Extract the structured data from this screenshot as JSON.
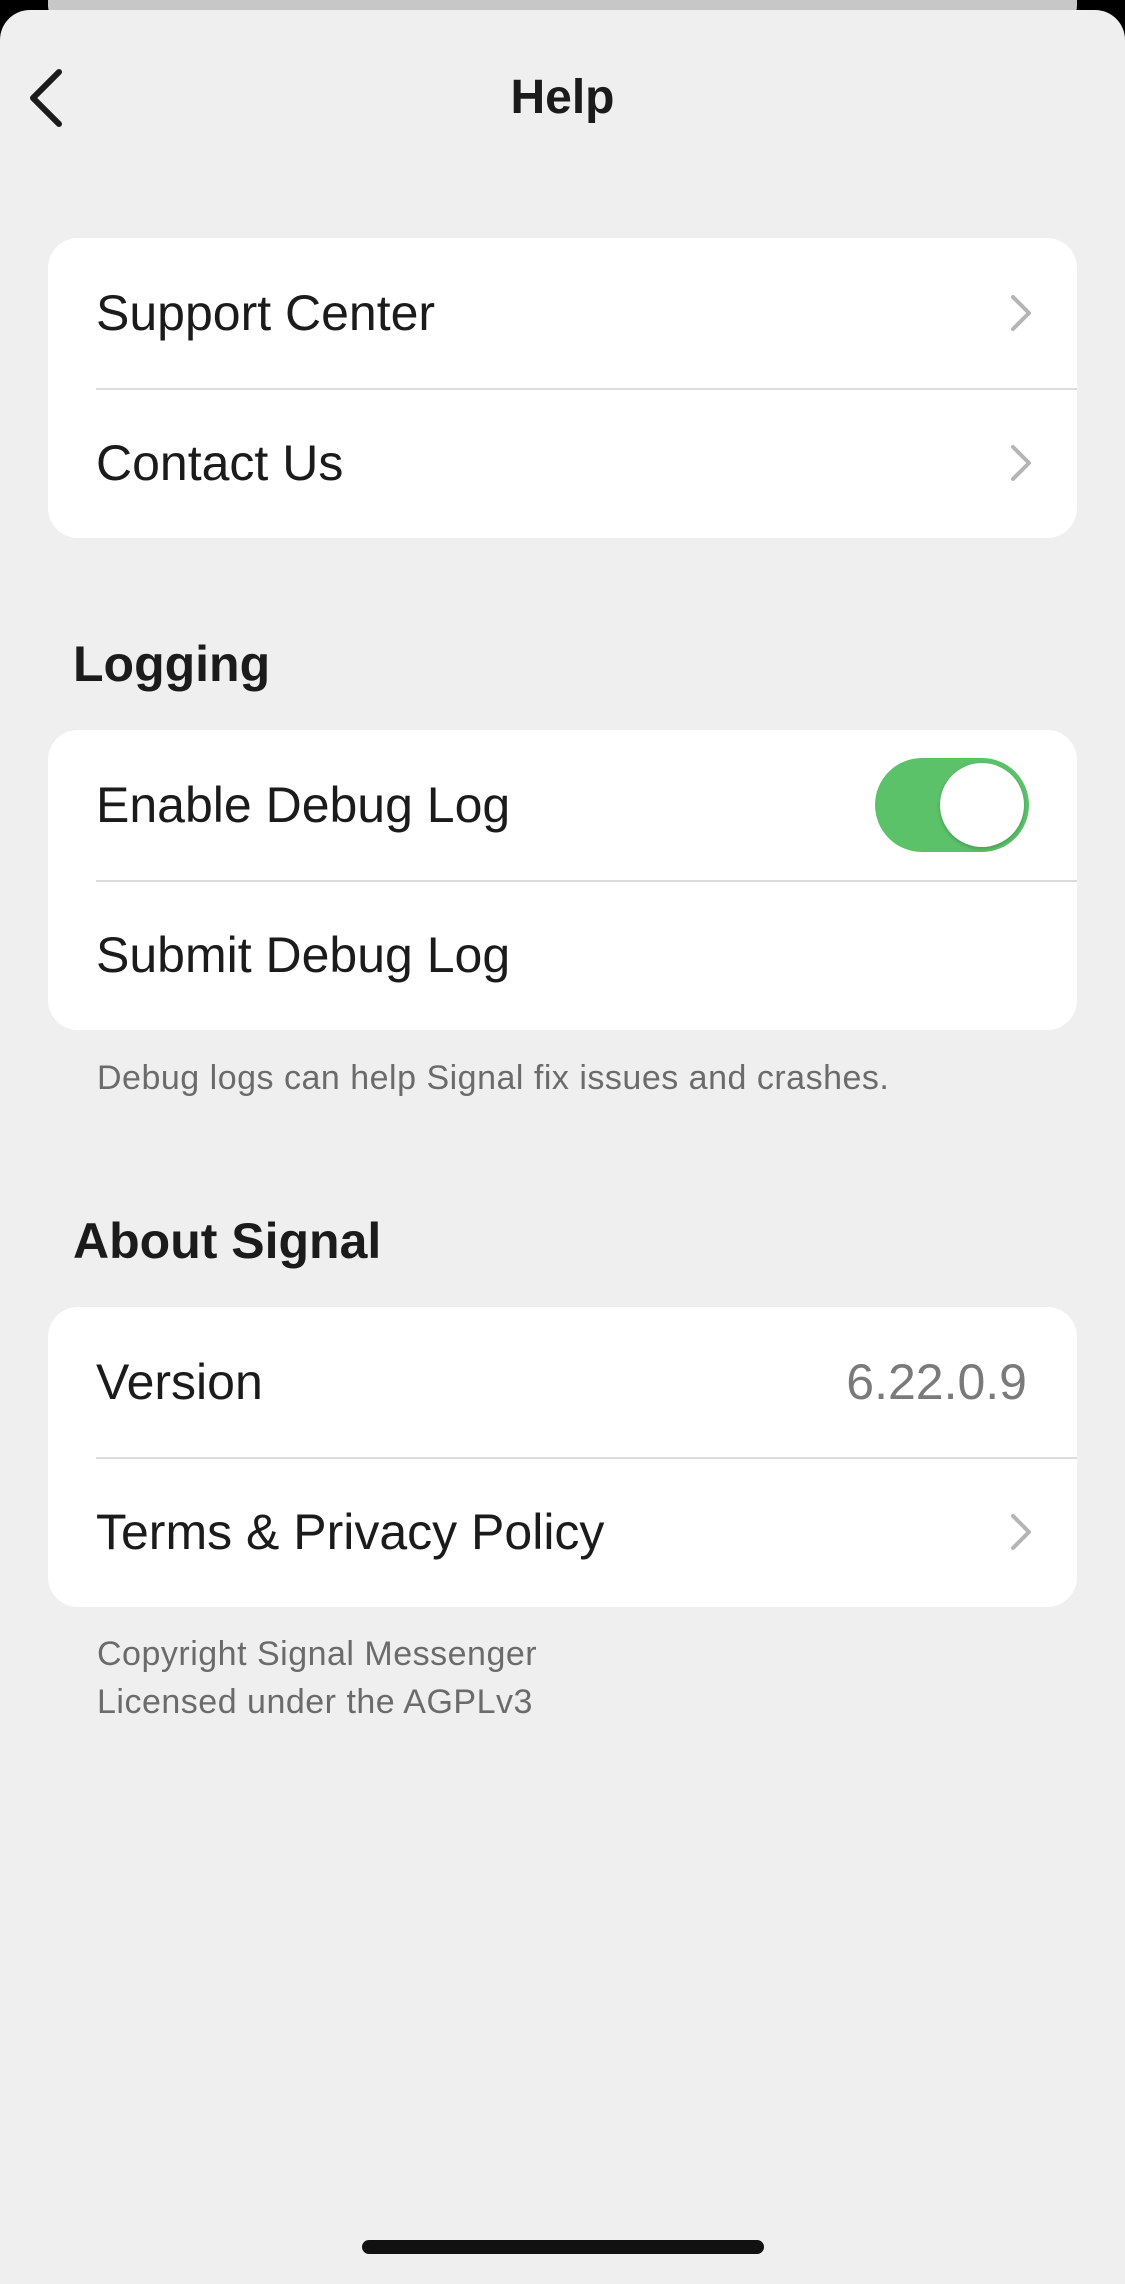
{
  "nav": {
    "title": "Help",
    "back_icon": "chevron-left-icon"
  },
  "support_group": {
    "items": [
      {
        "label": "Support Center",
        "icon": "chevron-right-icon"
      },
      {
        "label": "Contact Us",
        "icon": "chevron-right-icon"
      }
    ]
  },
  "logging": {
    "header": "Logging",
    "enable_debug_log": {
      "label": "Enable Debug Log",
      "enabled": true
    },
    "submit_debug_log": {
      "label": "Submit Debug Log"
    },
    "footer": "Debug logs can help Signal fix issues and crashes."
  },
  "about": {
    "header": "About Signal",
    "version_label": "Version",
    "version_value": "6.22.0.9",
    "terms_label": "Terms & Privacy Policy",
    "footer_line1": "Copyright Signal Messenger",
    "footer_line2": "Licensed under the AGPLv3"
  },
  "colors": {
    "background": "#efefef",
    "card": "#ffffff",
    "toggle_on": "#5bc26a",
    "text_primary": "#1b1b1b",
    "text_secondary": "#6b6b6b"
  }
}
